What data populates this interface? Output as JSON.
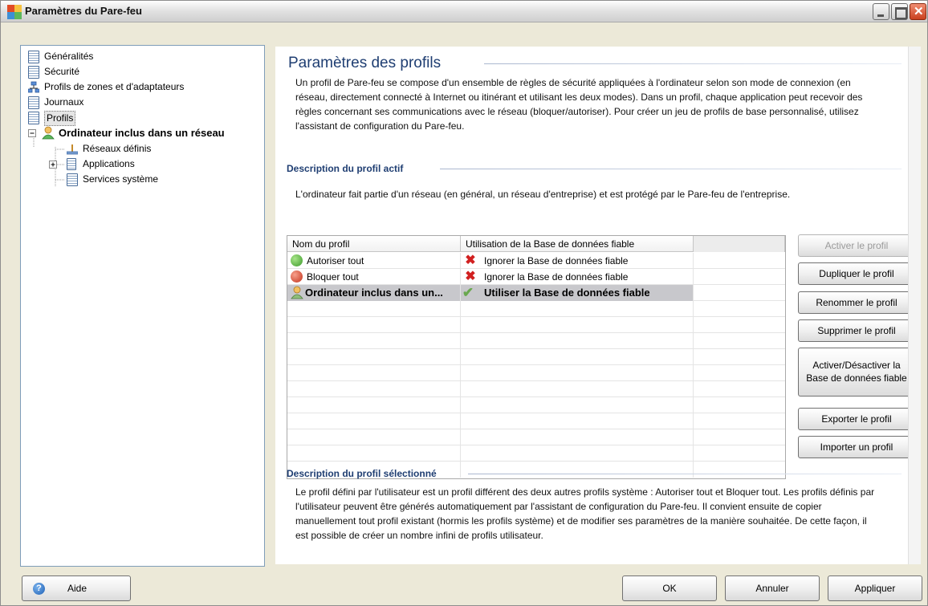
{
  "window": {
    "title": "Paramètres du Pare-feu"
  },
  "tree": {
    "items": [
      {
        "label": "Généralités"
      },
      {
        "label": "Sécurité"
      },
      {
        "label": "Profils de zones et d'adaptateurs"
      },
      {
        "label": "Journaux"
      },
      {
        "label": "Profils"
      },
      {
        "label": "Ordinateur inclus dans un réseau"
      },
      {
        "label": "Réseaux définis"
      },
      {
        "label": "Applications"
      },
      {
        "label": "Services système"
      }
    ]
  },
  "main": {
    "title": "Paramètres des profils",
    "intro_lines": [
      "Un profil de Pare-feu se compose d'un ensemble de règles de sécurité appliquées à l'ordinateur selon son mode de connexion (en",
      "réseau, directement connecté à Internet ou itinérant et utilisant les deux modes). Dans un profil, chaque application peut recevoir des",
      "règles concernant ses communications avec le réseau (bloquer/autoriser). Pour créer un jeu de profils de base personnalisé, utilisez",
      "l'assistant de configuration du Pare-feu."
    ],
    "active_heading": "Description du profil actif",
    "active_text": "L'ordinateur fait partie d'un réseau (en général, un réseau d'entreprise) et est protégé par le Pare-feu de l'entreprise.",
    "table": {
      "columns": [
        "Nom du profil",
        "Utilisation de la Base de données fiable"
      ],
      "rows": [
        {
          "name": "Autoriser tout",
          "usage": "Ignorer la Base de données fiable"
        },
        {
          "name": "Bloquer tout",
          "usage": "Ignorer la Base de données fiable"
        },
        {
          "name": "Ordinateur inclus dans un...",
          "usage": "Utiliser la Base de données fiable"
        }
      ]
    },
    "side_buttons": {
      "activate": "Activer le profil",
      "duplicate": "Dupliquer le profil",
      "rename": "Renommer le profil",
      "delete": "Supprimer le profil",
      "toggle_line1": "Activer/Désactiver la",
      "toggle_line2": "Base de données fiable",
      "export": "Exporter le profil",
      "import": "Importer un profil"
    },
    "selected_heading": "Description du profil sélectionné",
    "selected_lines": [
      "Le profil défini par l'utilisateur est un profil différent des deux autres profils système : Autoriser tout et Bloquer tout. Les profils définis par",
      "l'utilisateur peuvent être générés automatiquement par l'assistant de configuration du Pare-feu. Il convient ensuite de copier",
      "manuellement tout profil existant (hormis les profils système) et de modifier ses paramètres de la manière souhaitée. De cette façon, il",
      "est possible de créer un nombre infini de profils utilisateur."
    ]
  },
  "footer": {
    "help": "Aide",
    "ok": "OK",
    "cancel": "Annuler",
    "apply": "Appliquer"
  },
  "colors": {
    "heading": "#1f3e72",
    "border": "#7f9db9"
  }
}
